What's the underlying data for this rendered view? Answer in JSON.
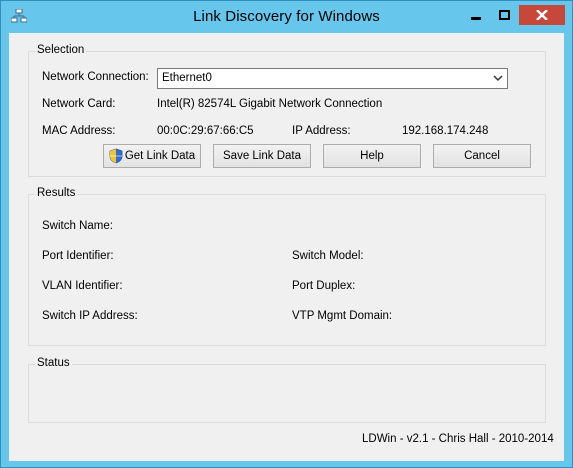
{
  "window": {
    "title": "Link Discovery for Windows",
    "app_icon": "network-icon"
  },
  "selection": {
    "legend": "Selection",
    "network_connection_label": "Network Connection:",
    "network_connection_value": "Ethernet0",
    "network_card_label": "Network Card:",
    "network_card_value": "Intel(R) 82574L Gigabit Network Connection",
    "mac_label": "MAC Address:",
    "mac_value": "00:0C:29:67:66:C5",
    "ip_label": "IP Address:",
    "ip_value": "192.168.174.248"
  },
  "buttons": {
    "get_link_data": "Get Link Data",
    "save_link_data": "Save Link Data",
    "help": "Help",
    "cancel": "Cancel"
  },
  "results": {
    "legend": "Results",
    "switch_name_label": "Switch Name:",
    "port_identifier_label": "Port Identifier:",
    "switch_model_label": "Switch Model:",
    "vlan_identifier_label": "VLAN Identifier:",
    "port_duplex_label": "Port Duplex:",
    "switch_ip_label": "Switch IP Address:",
    "vtp_domain_label": "VTP Mgmt Domain:"
  },
  "status": {
    "legend": "Status"
  },
  "footer": {
    "version_text": "LDWin - v2.1 - Chris Hall - 2010-2014"
  },
  "colors": {
    "titlebar": "#66c6ec",
    "close_button": "#c7483b",
    "client_background": "#f0f0f0"
  }
}
